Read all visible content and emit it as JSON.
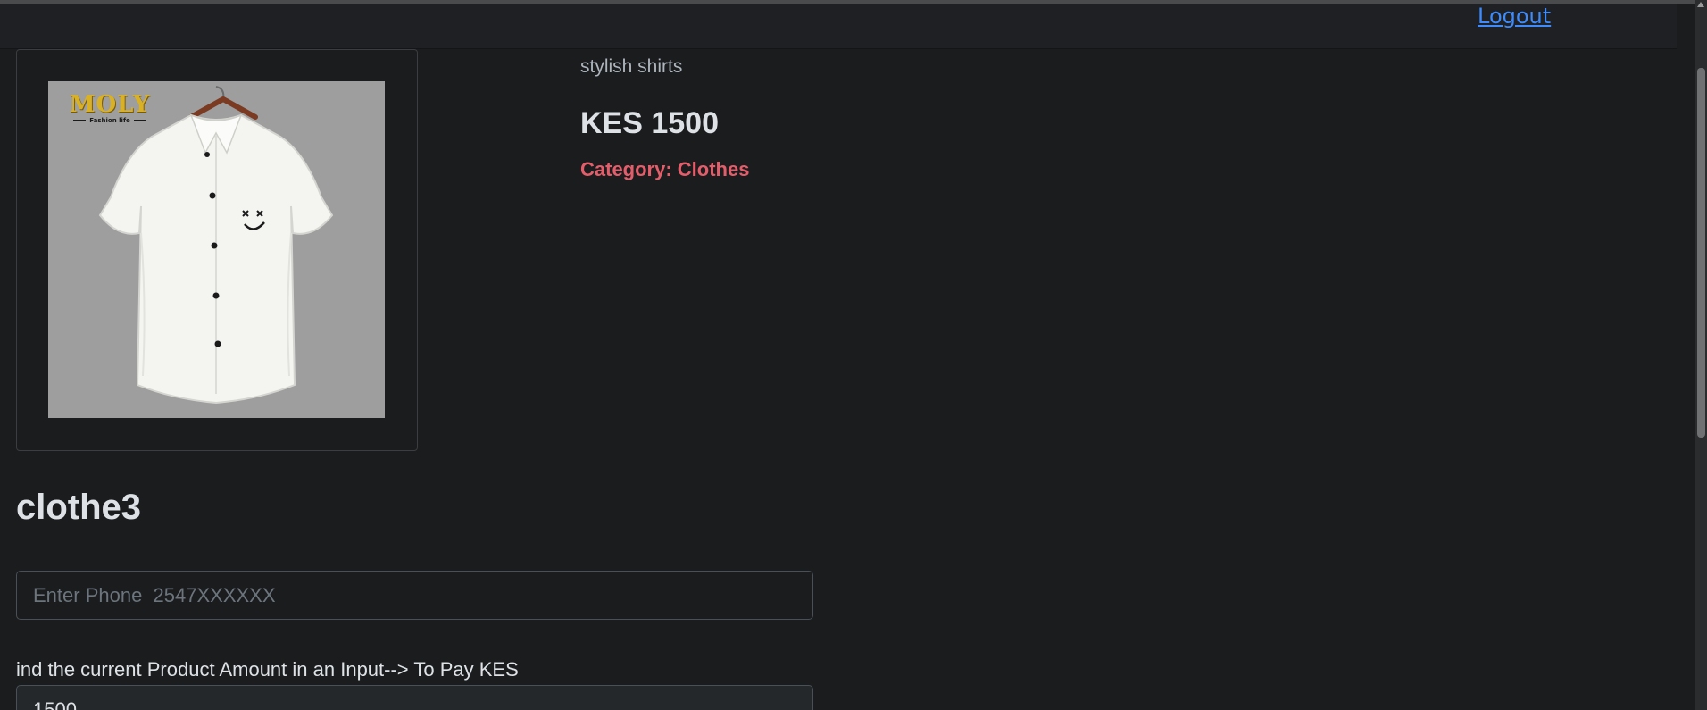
{
  "navbar": {
    "logout_label": "Logout"
  },
  "product": {
    "image_alt": "white short-sleeve shirt",
    "brand_name": "MOLY",
    "brand_tagline": "Fashion life",
    "description": "stylish shirts",
    "price": "KES 1500",
    "category": "Category: Clothes",
    "title": "clothe3"
  },
  "payment_form": {
    "phone_placeholder": "Enter Phone  2547XXXXXX",
    "amount_label": "ind the current Product Amount in an Input--> To Pay KES",
    "amount_value": "1500"
  },
  "colors": {
    "background": "#1b1c1e",
    "link": "#3d8bfd",
    "category_accent": "#e35d6a"
  }
}
